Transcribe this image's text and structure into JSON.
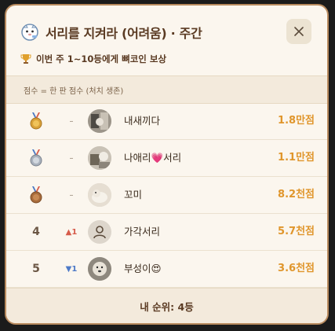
{
  "header": {
    "title": "서리를 지켜라 (어려움) · 주간",
    "reward_text": "이번 주 1~10등에게 뼈코인 보상",
    "close_icon": "close-icon"
  },
  "subheader": {
    "score_note": "점수 = 한 판 점수 (처치 생존)"
  },
  "colors": {
    "accent": "#e0962c",
    "title": "#5a3a22",
    "gold": "#c8962c",
    "silver": "#9aa4b0",
    "bronze": "#a86c3c",
    "up": "#d65b4a",
    "down": "#4e7ac7"
  },
  "leaderboard": [
    {
      "rank": "1",
      "medal": "gold-medal-icon",
      "change": "–",
      "change_dir": "none",
      "name": "내새끼다",
      "score": "1.8만점",
      "avatar": "photo"
    },
    {
      "rank": "2",
      "medal": "silver-medal-icon",
      "change": "–",
      "change_dir": "none",
      "name": "나애리💗서리",
      "score": "1.1만점",
      "avatar": "photo"
    },
    {
      "rank": "3",
      "medal": "bronze-medal-icon",
      "change": "–",
      "change_dir": "none",
      "name": "꼬미",
      "score": "8.2천점",
      "avatar": "photo"
    },
    {
      "rank": "4",
      "medal": "",
      "change": "1",
      "change_dir": "up",
      "name": "가각서리",
      "score": "5.7천점",
      "avatar": "default"
    },
    {
      "rank": "5",
      "medal": "",
      "change": "1",
      "change_dir": "down",
      "name": "부성이😍",
      "score": "3.6천점",
      "avatar": "photo"
    }
  ],
  "footer": {
    "my_rank": "내 순위: 4등"
  }
}
